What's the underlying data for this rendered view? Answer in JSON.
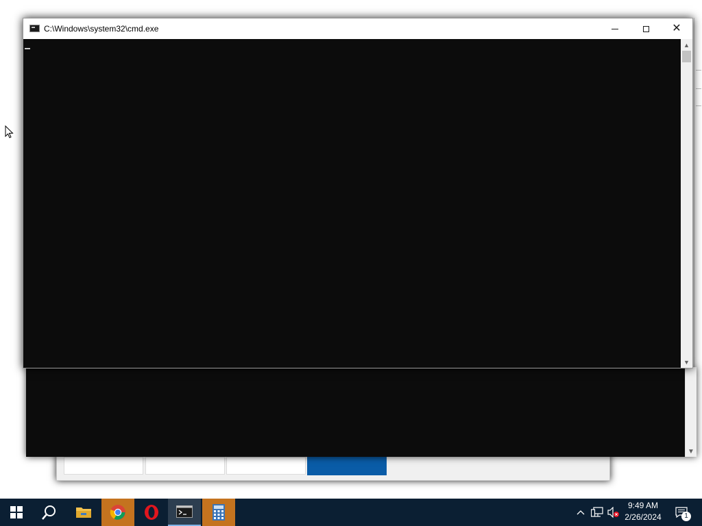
{
  "cmd_window": {
    "title": "C:\\Windows\\system32\\cmd.exe",
    "minimize_label": "Minimize",
    "maximize_label": "Maximize",
    "close_label": "Close",
    "console_text": ""
  },
  "taskbar": {
    "items": [
      {
        "name": "start",
        "icon": "windows-logo-icon"
      },
      {
        "name": "search",
        "icon": "search-icon"
      },
      {
        "name": "file-explorer",
        "icon": "folder-icon"
      },
      {
        "name": "chrome",
        "icon": "chrome-icon",
        "state": "highlighted"
      },
      {
        "name": "opera",
        "icon": "opera-icon"
      },
      {
        "name": "cmd",
        "icon": "terminal-icon",
        "state": "active"
      },
      {
        "name": "calculator",
        "icon": "calculator-icon",
        "state": "highlighted"
      }
    ],
    "clock": {
      "time": "9:49 AM",
      "date": "2/26/2024"
    },
    "notification_count": "1"
  },
  "colors": {
    "taskbar_bg": "#0b1f33",
    "console_bg": "#0c0c0c",
    "highlight": "#c4731f",
    "dialog_accent": "#0a5ca7"
  }
}
